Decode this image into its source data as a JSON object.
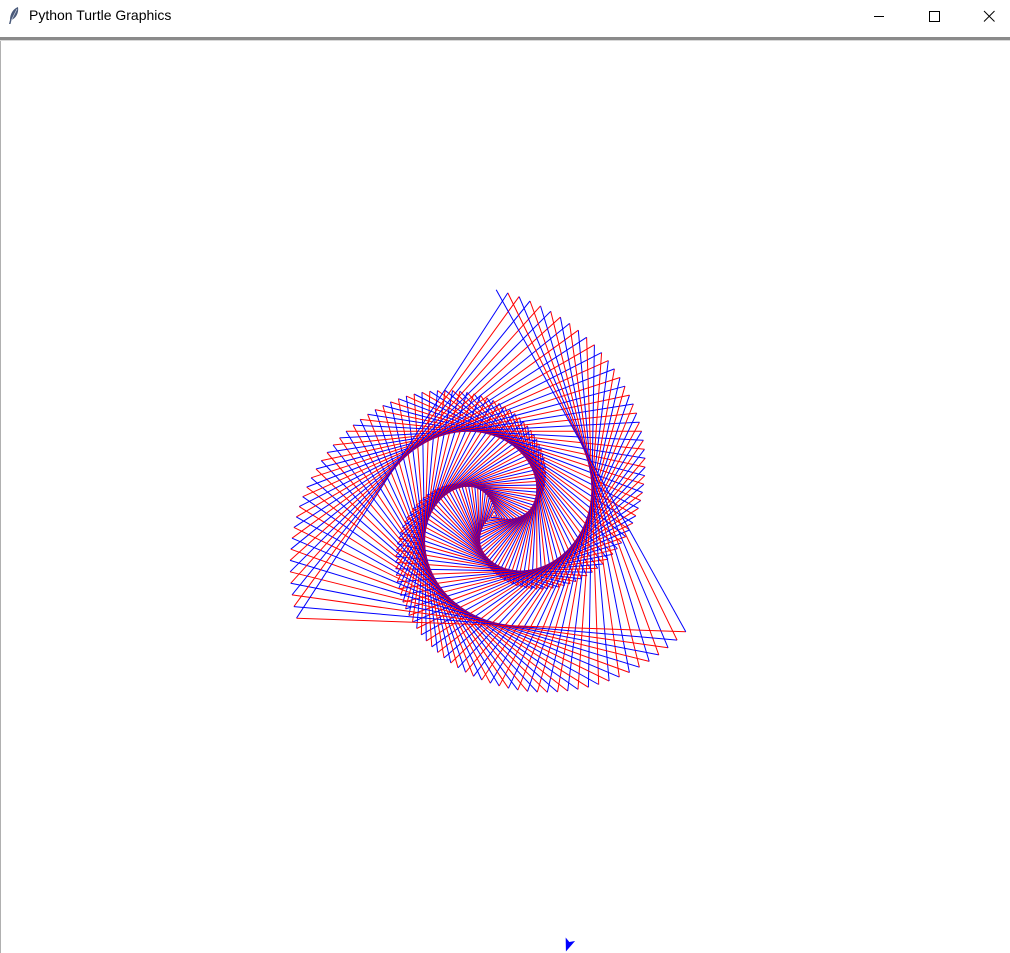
{
  "window": {
    "title": "Python Turtle Graphics",
    "controls": {
      "minimize": "minimize",
      "maximize": "maximize",
      "close": "close"
    }
  },
  "canvas": {
    "background": "#ffffff",
    "pen_colors": [
      "#ff0000",
      "#0000ff"
    ],
    "turtle_icon": "arrow-cursor-icon",
    "turtle_color": "#0000ff"
  }
}
